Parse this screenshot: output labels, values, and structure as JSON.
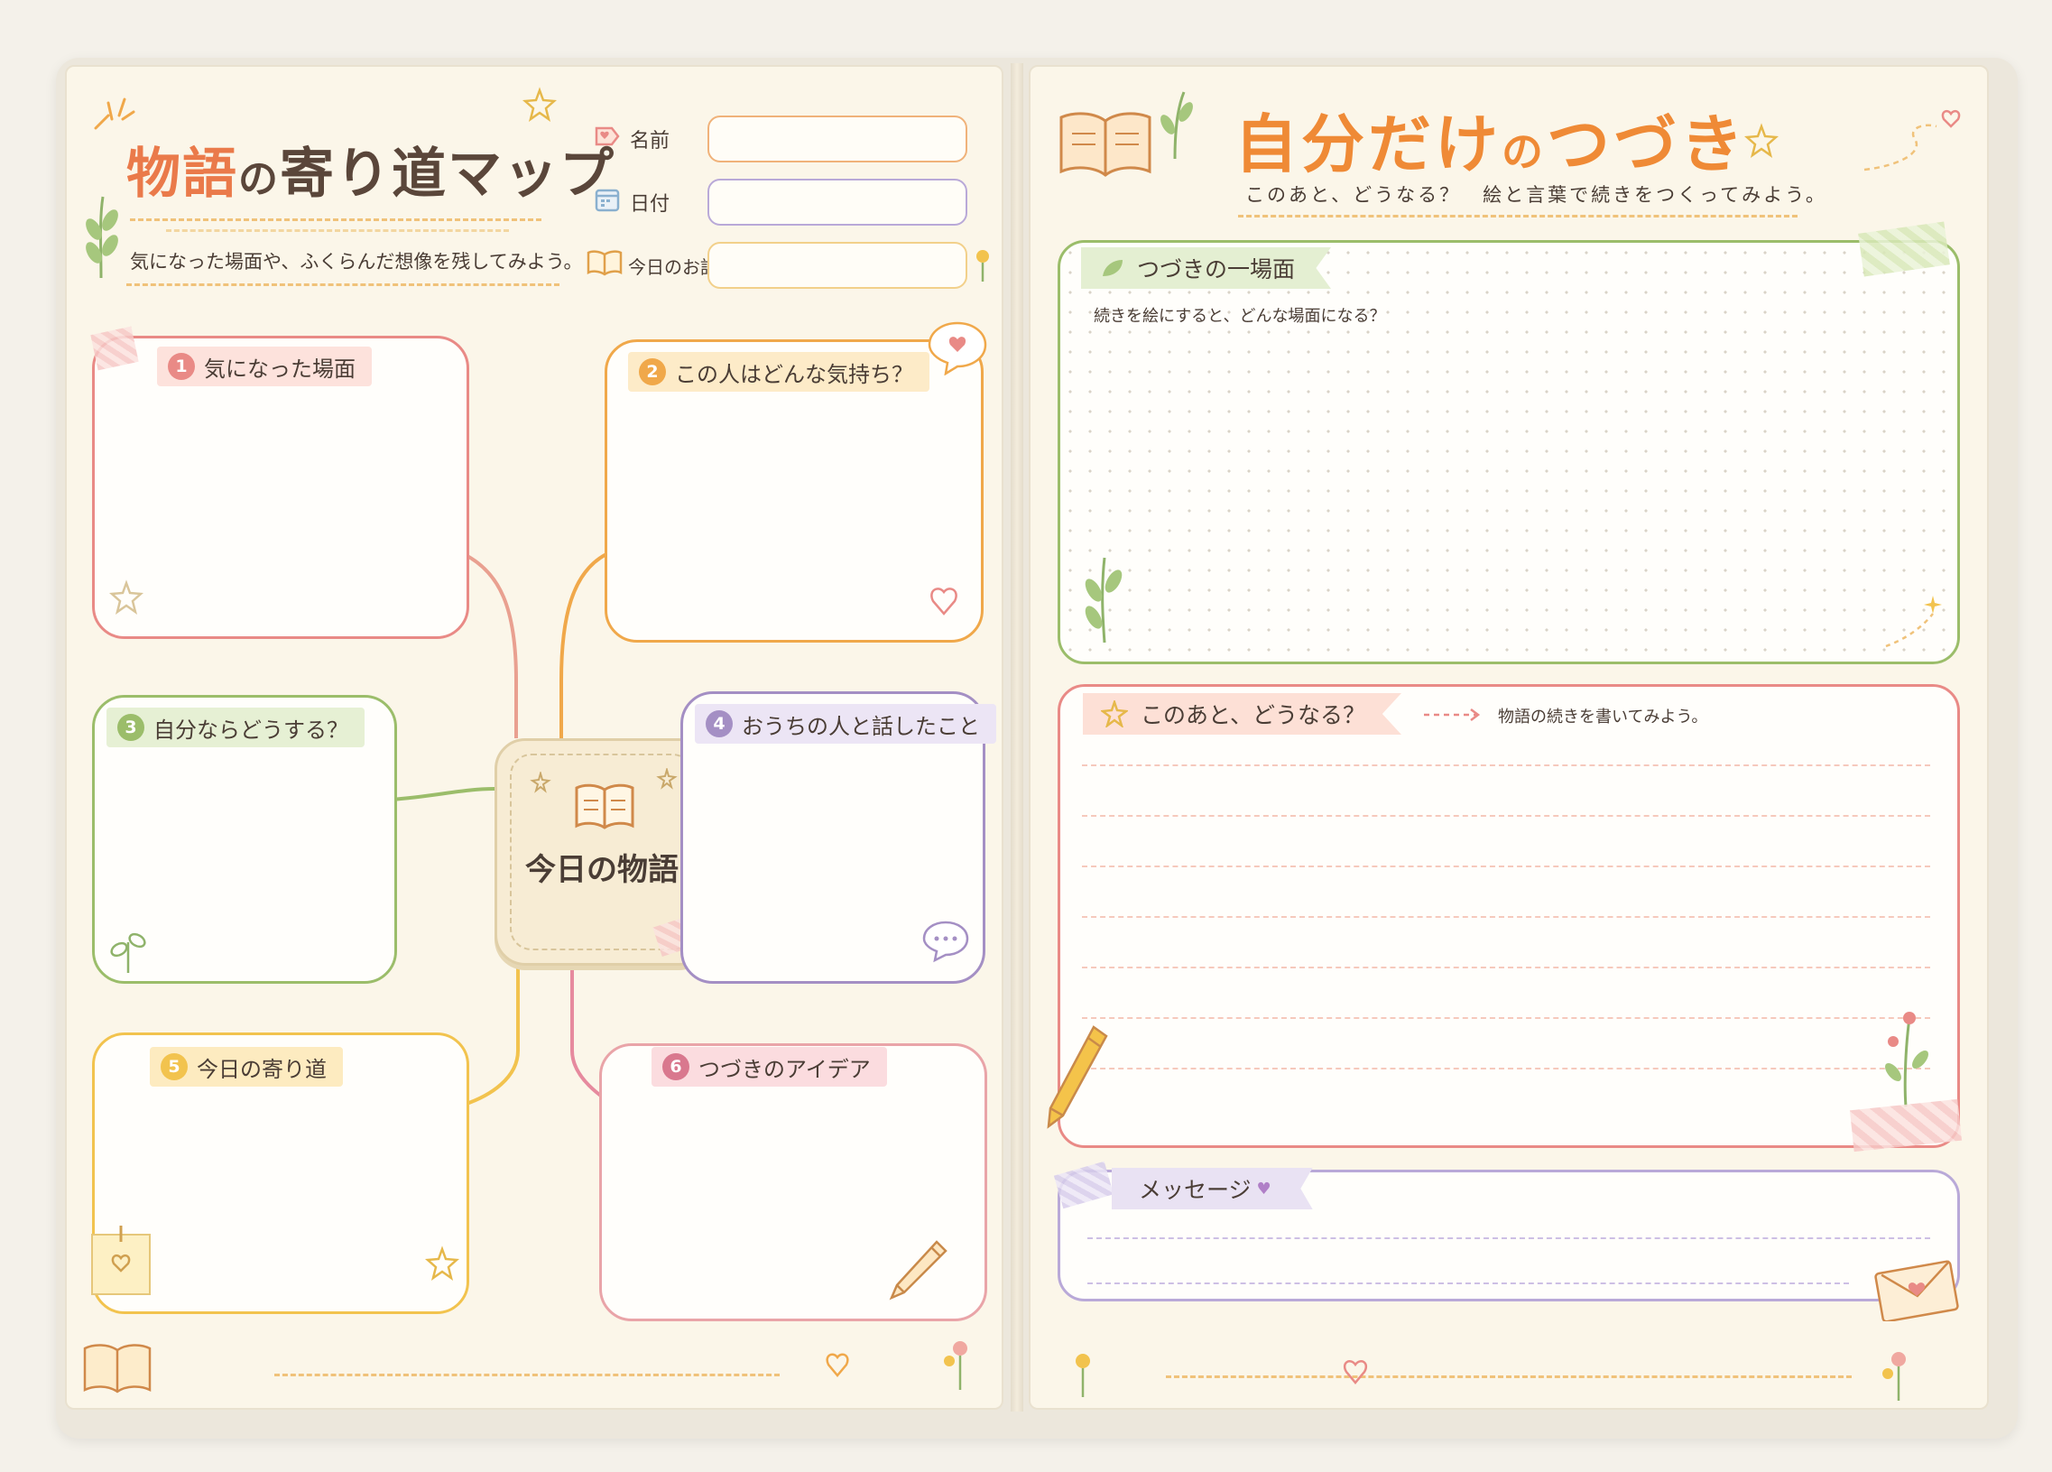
{
  "left": {
    "title_part1": "物語",
    "title_part2": "の",
    "title_part3": "寄り道マップ",
    "subtitle": "気になった場面や、ふくらんだ想像を残してみよう。",
    "fields": [
      {
        "label": "名前",
        "value": ""
      },
      {
        "label": "日付",
        "value": ""
      },
      {
        "label": "今日のお話",
        "value": ""
      }
    ],
    "center_label": "今日の物語",
    "boxes": [
      {
        "num": "1",
        "label": "気になった場面"
      },
      {
        "num": "2",
        "label": "この人はどんな気持ち？"
      },
      {
        "num": "3",
        "label": "自分ならどうする？"
      },
      {
        "num": "4",
        "label": "おうちの人と話したこと"
      },
      {
        "num": "5",
        "label": "今日の寄り道"
      },
      {
        "num": "6",
        "label": "つづきのアイデア"
      }
    ]
  },
  "right": {
    "title_part1": "自分だけ",
    "title_part2": "の",
    "title_part3": "つづき",
    "subtitle": "このあと、どうなる？　絵と言葉で続きをつくってみよう。",
    "scene": {
      "label": "つづきの一場面",
      "prompt": "続きを絵にすると、どんな場面になる？"
    },
    "next": {
      "label": "このあと、どうなる？",
      "hint": "物語の続きを書いてみよう。"
    },
    "message": {
      "label": "メッセージ"
    }
  },
  "colors": {
    "red": "#e98a86",
    "orange": "#f0a84a",
    "green": "#9bbd6a",
    "purple": "#a48fc4",
    "yellow": "#f2c34e",
    "pink": "#e68a9e"
  }
}
